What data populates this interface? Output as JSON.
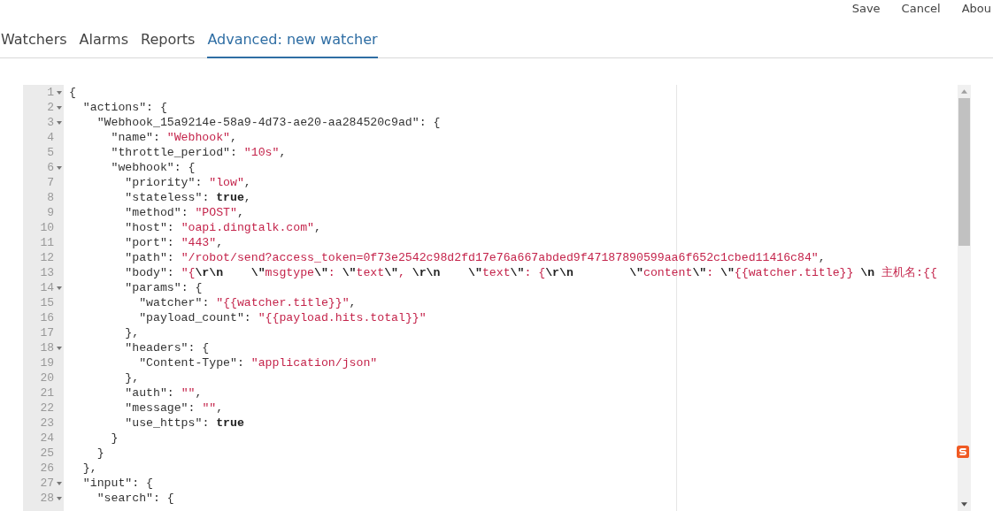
{
  "header": {
    "actions": [
      {
        "label": "Save"
      },
      {
        "label": "Cancel"
      },
      {
        "label": "Abou"
      }
    ]
  },
  "tabs": [
    {
      "label": "Watchers",
      "selected": false
    },
    {
      "label": "Alarms",
      "selected": false
    },
    {
      "label": "Reports",
      "selected": false
    },
    {
      "label": "Advanced: new watcher",
      "selected": true
    }
  ],
  "editor": {
    "lines": [
      {
        "number": "1",
        "foldable": true,
        "tokens": [
          {
            "kind": "punct",
            "text": "{"
          }
        ]
      },
      {
        "number": "2",
        "foldable": true,
        "tokens": [
          {
            "kind": "key",
            "text": "  \"actions\""
          },
          {
            "kind": "punct",
            "text": ": {"
          }
        ]
      },
      {
        "number": "3",
        "foldable": true,
        "tokens": [
          {
            "kind": "key",
            "text": "    \"Webhook_15a9214e-58a9-4d73-ae20-aa284520c9ad\""
          },
          {
            "kind": "punct",
            "text": ": {"
          }
        ]
      },
      {
        "number": "4",
        "foldable": false,
        "tokens": [
          {
            "kind": "key",
            "text": "      \"name\""
          },
          {
            "kind": "punct",
            "text": ": "
          },
          {
            "kind": "string",
            "text": "\"Webhook\""
          },
          {
            "kind": "punct",
            "text": ","
          }
        ]
      },
      {
        "number": "5",
        "foldable": false,
        "tokens": [
          {
            "kind": "key",
            "text": "      \"throttle_period\""
          },
          {
            "kind": "punct",
            "text": ": "
          },
          {
            "kind": "string",
            "text": "\"10s\""
          },
          {
            "kind": "punct",
            "text": ","
          }
        ]
      },
      {
        "number": "6",
        "foldable": true,
        "tokens": [
          {
            "kind": "key",
            "text": "      \"webhook\""
          },
          {
            "kind": "punct",
            "text": ": {"
          }
        ]
      },
      {
        "number": "7",
        "foldable": false,
        "tokens": [
          {
            "kind": "key",
            "text": "        \"priority\""
          },
          {
            "kind": "punct",
            "text": ": "
          },
          {
            "kind": "string",
            "text": "\"low\""
          },
          {
            "kind": "punct",
            "text": ","
          }
        ]
      },
      {
        "number": "8",
        "foldable": false,
        "tokens": [
          {
            "kind": "key",
            "text": "        \"stateless\""
          },
          {
            "kind": "punct",
            "text": ": "
          },
          {
            "kind": "boolean",
            "text": "true"
          },
          {
            "kind": "punct",
            "text": ","
          }
        ]
      },
      {
        "number": "9",
        "foldable": false,
        "tokens": [
          {
            "kind": "key",
            "text": "        \"method\""
          },
          {
            "kind": "punct",
            "text": ": "
          },
          {
            "kind": "string",
            "text": "\"POST\""
          },
          {
            "kind": "punct",
            "text": ","
          }
        ]
      },
      {
        "number": "10",
        "foldable": false,
        "tokens": [
          {
            "kind": "key",
            "text": "        \"host\""
          },
          {
            "kind": "punct",
            "text": ": "
          },
          {
            "kind": "string",
            "text": "\"oapi.dingtalk.com\""
          },
          {
            "kind": "punct",
            "text": ","
          }
        ]
      },
      {
        "number": "11",
        "foldable": false,
        "tokens": [
          {
            "kind": "key",
            "text": "        \"port\""
          },
          {
            "kind": "punct",
            "text": ": "
          },
          {
            "kind": "string",
            "text": "\"443\""
          },
          {
            "kind": "punct",
            "text": ","
          }
        ]
      },
      {
        "number": "12",
        "foldable": false,
        "tokens": [
          {
            "kind": "key",
            "text": "        \"path\""
          },
          {
            "kind": "punct",
            "text": ": "
          },
          {
            "kind": "string",
            "text": "\"/robot/send?access_token=0f73e2542c98d2fd17e76a667abded9f47187890599aa6f652c1cbed11416c84\""
          },
          {
            "kind": "punct",
            "text": ","
          }
        ]
      },
      {
        "number": "13",
        "foldable": false,
        "tokens": [
          {
            "kind": "key",
            "text": "        \"body\""
          },
          {
            "kind": "punct",
            "text": ": "
          },
          {
            "kind": "string",
            "text": "\"{"
          },
          {
            "kind": "escape",
            "text": "\\r\\n    \\\""
          },
          {
            "kind": "string",
            "text": "msgtype"
          },
          {
            "kind": "escape",
            "text": "\\\""
          },
          {
            "kind": "string",
            "text": ": "
          },
          {
            "kind": "escape",
            "text": "\\\""
          },
          {
            "kind": "string",
            "text": "text"
          },
          {
            "kind": "escape",
            "text": "\\\""
          },
          {
            "kind": "string",
            "text": ", "
          },
          {
            "kind": "escape",
            "text": "\\r\\n    \\\""
          },
          {
            "kind": "string",
            "text": "text"
          },
          {
            "kind": "escape",
            "text": "\\\""
          },
          {
            "kind": "string",
            "text": ": {"
          },
          {
            "kind": "escape",
            "text": "\\r\\n        \\\""
          },
          {
            "kind": "string",
            "text": "content"
          },
          {
            "kind": "escape",
            "text": "\\\""
          },
          {
            "kind": "string",
            "text": ": "
          },
          {
            "kind": "escape",
            "text": "\\\""
          },
          {
            "kind": "string",
            "text": "{{watcher.title}} "
          },
          {
            "kind": "escape",
            "text": "\\n"
          },
          {
            "kind": "string",
            "text": " 主机名:{{"
          }
        ]
      },
      {
        "number": "14",
        "foldable": true,
        "tokens": [
          {
            "kind": "key",
            "text": "        \"params\""
          },
          {
            "kind": "punct",
            "text": ": {"
          }
        ]
      },
      {
        "number": "15",
        "foldable": false,
        "tokens": [
          {
            "kind": "key",
            "text": "          \"watcher\""
          },
          {
            "kind": "punct",
            "text": ": "
          },
          {
            "kind": "string",
            "text": "\"{{watcher.title}}\""
          },
          {
            "kind": "punct",
            "text": ","
          }
        ]
      },
      {
        "number": "16",
        "foldable": false,
        "tokens": [
          {
            "kind": "key",
            "text": "          \"payload_count\""
          },
          {
            "kind": "punct",
            "text": ": "
          },
          {
            "kind": "string",
            "text": "\"{{payload.hits.total}}\""
          }
        ]
      },
      {
        "number": "17",
        "foldable": false,
        "tokens": [
          {
            "kind": "punct",
            "text": "        },"
          }
        ]
      },
      {
        "number": "18",
        "foldable": true,
        "tokens": [
          {
            "kind": "key",
            "text": "        \"headers\""
          },
          {
            "kind": "punct",
            "text": ": {"
          }
        ]
      },
      {
        "number": "19",
        "foldable": false,
        "tokens": [
          {
            "kind": "key",
            "text": "          \"Content-Type\""
          },
          {
            "kind": "punct",
            "text": ": "
          },
          {
            "kind": "string",
            "text": "\"application/json\""
          }
        ]
      },
      {
        "number": "20",
        "foldable": false,
        "tokens": [
          {
            "kind": "punct",
            "text": "        },"
          }
        ]
      },
      {
        "number": "21",
        "foldable": false,
        "tokens": [
          {
            "kind": "key",
            "text": "        \"auth\""
          },
          {
            "kind": "punct",
            "text": ": "
          },
          {
            "kind": "string",
            "text": "\"\""
          },
          {
            "kind": "punct",
            "text": ","
          }
        ]
      },
      {
        "number": "22",
        "foldable": false,
        "tokens": [
          {
            "kind": "key",
            "text": "        \"message\""
          },
          {
            "kind": "punct",
            "text": ": "
          },
          {
            "kind": "string",
            "text": "\"\""
          },
          {
            "kind": "punct",
            "text": ","
          }
        ]
      },
      {
        "number": "23",
        "foldable": false,
        "tokens": [
          {
            "kind": "key",
            "text": "        \"use_https\""
          },
          {
            "kind": "punct",
            "text": ": "
          },
          {
            "kind": "boolean",
            "text": "true"
          }
        ]
      },
      {
        "number": "24",
        "foldable": false,
        "tokens": [
          {
            "kind": "punct",
            "text": "      }"
          }
        ]
      },
      {
        "number": "25",
        "foldable": false,
        "tokens": [
          {
            "kind": "punct",
            "text": "    }"
          }
        ]
      },
      {
        "number": "26",
        "foldable": false,
        "tokens": [
          {
            "kind": "punct",
            "text": "  },"
          }
        ]
      },
      {
        "number": "27",
        "foldable": true,
        "tokens": [
          {
            "kind": "key",
            "text": "  \"input\""
          },
          {
            "kind": "punct",
            "text": ": {"
          }
        ]
      },
      {
        "number": "28",
        "foldable": true,
        "tokens": [
          {
            "kind": "key",
            "text": "    \"search\""
          },
          {
            "kind": "punct",
            "text": ": {"
          }
        ]
      }
    ]
  }
}
